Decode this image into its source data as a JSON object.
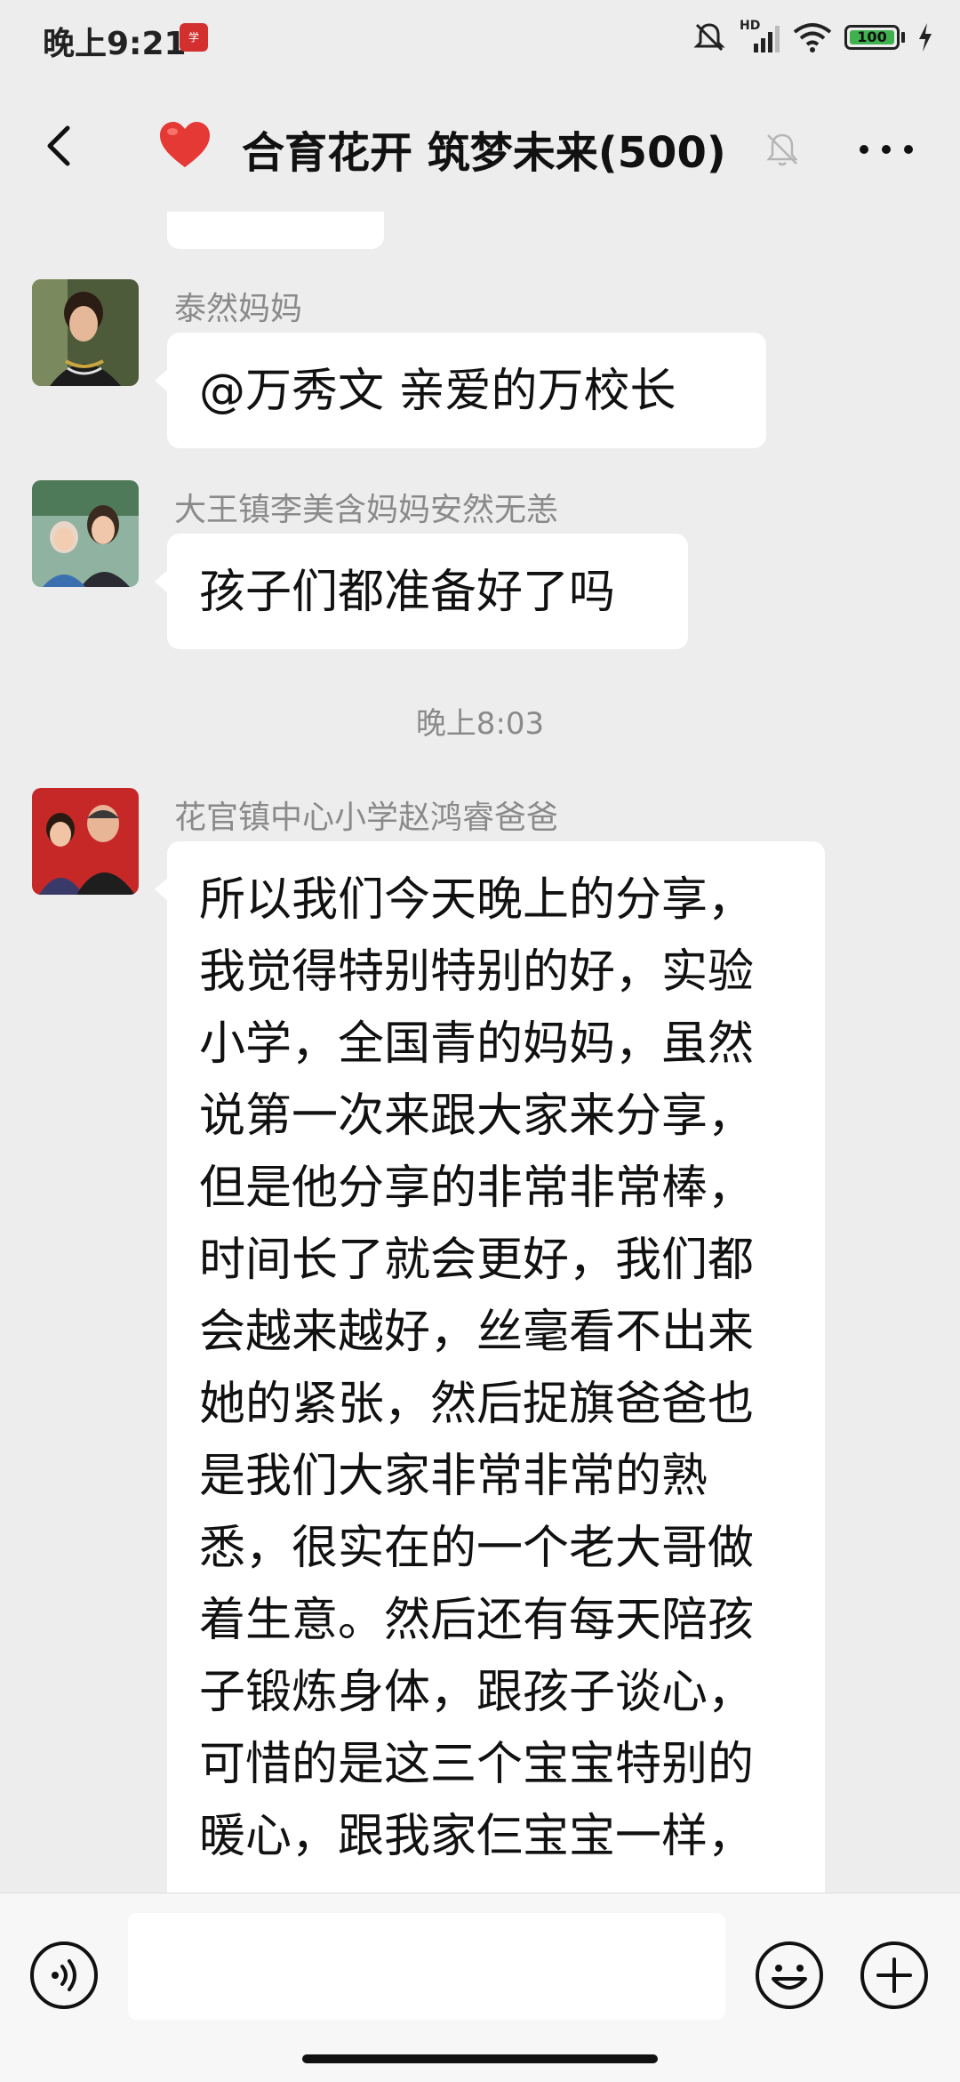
{
  "status_bar": {
    "time": "晚上9:21",
    "signal_label": "HD",
    "battery_level": "100"
  },
  "header": {
    "title": "合育花开 筑梦未来(500)",
    "heart_icon": "heart-icon",
    "muted": true
  },
  "messages": [
    {
      "sender": "泰然妈妈",
      "text": "@万秀文  亲爱的万校长",
      "avatar": "woman-portrait"
    },
    {
      "sender": "大王镇李美含妈妈安然无恙",
      "text": "孩子们都准备好了吗",
      "avatar": "mother-daughter-photo"
    },
    {
      "sender": "花官镇中心小学赵鸿睿爸爸",
      "lines": [
        "所以我们今天晚上的分享，",
        "我觉得特别特别的好，实验",
        "小学，全国青的妈妈，虽然",
        "说第一次来跟大家来分享，",
        "但是他分享的非常非常棒，",
        "时间长了就会更好，我们都",
        "会越来越好，丝毫看不出来",
        "她的紧张，然后捉旗爸爸也",
        "是我们大家非常非常的熟",
        "悉，很实在的一个老大哥做",
        "着生意。然后还有每天陪孩",
        "子锻炼身体，跟孩子谈心，",
        "可惜的是这三个宝宝特别的",
        "暖心，跟我家仨宝宝一样，"
      ],
      "avatar": "father-son-photo"
    }
  ],
  "timestamp": "晚上8:03",
  "input": {
    "value": "",
    "placeholder": ""
  },
  "colors": {
    "background": "#ededed",
    "bubble": "#ffffff",
    "accent_red": "#e53935",
    "battery_green": "#3fb24f"
  }
}
